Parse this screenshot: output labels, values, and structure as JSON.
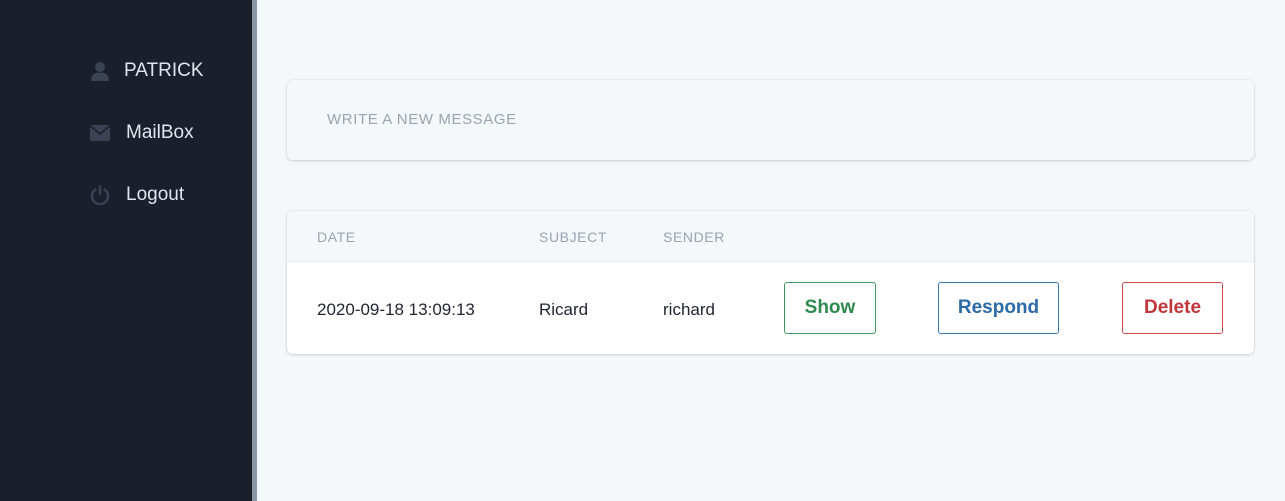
{
  "sidebar": {
    "items": [
      {
        "label": "PATRICK",
        "icon": "user-icon"
      },
      {
        "label": "MailBox",
        "icon": "envelope-icon"
      },
      {
        "label": "Logout",
        "icon": "power-icon"
      }
    ]
  },
  "compose": {
    "placeholder": "WRITE A NEW MESSAGE"
  },
  "table": {
    "columns": [
      "DATE",
      "SUBJECT",
      "SENDER"
    ],
    "rows": [
      {
        "date": "2020-09-18 13:09:13",
        "subject": "Ricard",
        "sender": "richard",
        "actions": {
          "show": "Show",
          "respond": "Respond",
          "delete": "Delete"
        }
      }
    ]
  },
  "colors": {
    "sidebar_bg": "#1b1f2b",
    "show": "#2f8a50",
    "respond": "#2c6aa8",
    "delete": "#c0363b"
  }
}
